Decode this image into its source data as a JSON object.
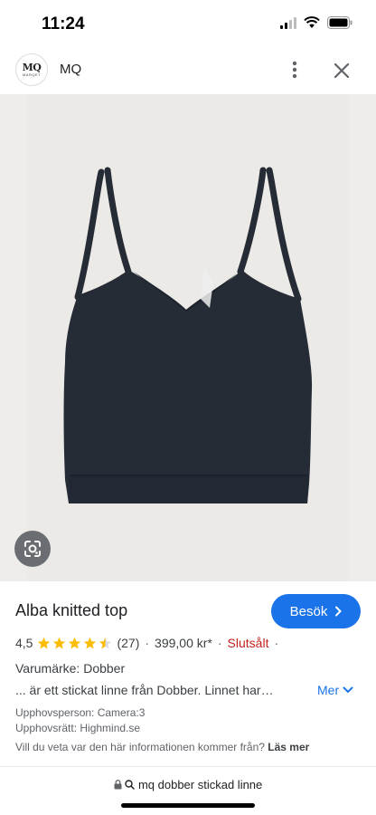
{
  "status_bar": {
    "time": "11:24"
  },
  "header": {
    "site_name": "MQ",
    "logo_text": "MQ",
    "logo_subtext": "MARQET"
  },
  "product": {
    "title": "Alba knitted top",
    "visit_label": "Besök",
    "rating": "4,5",
    "rating_value": 4.5,
    "rating_max": 5,
    "review_count": "(27)",
    "price": "399,00 kr*",
    "availability": "Slutsålt",
    "brand_line": "Varumärke: Dobber",
    "description": "... är ett stickat linne från Dobber. Linnet har…",
    "more_label": "Mer",
    "photographer": "Upphovsperson: Camera:3",
    "copyright": "Upphovsrätt: Highmind.se",
    "source_question": "Vill du veta var den här informationen kommer från?",
    "learn_more": "Läs mer"
  },
  "url_bar": {
    "query": "mq dobber stickad linne"
  },
  "colors": {
    "accent": "#1a73e8",
    "sold_out": "#c5221f",
    "star": "#fbbc04",
    "garment": "#262c36"
  }
}
